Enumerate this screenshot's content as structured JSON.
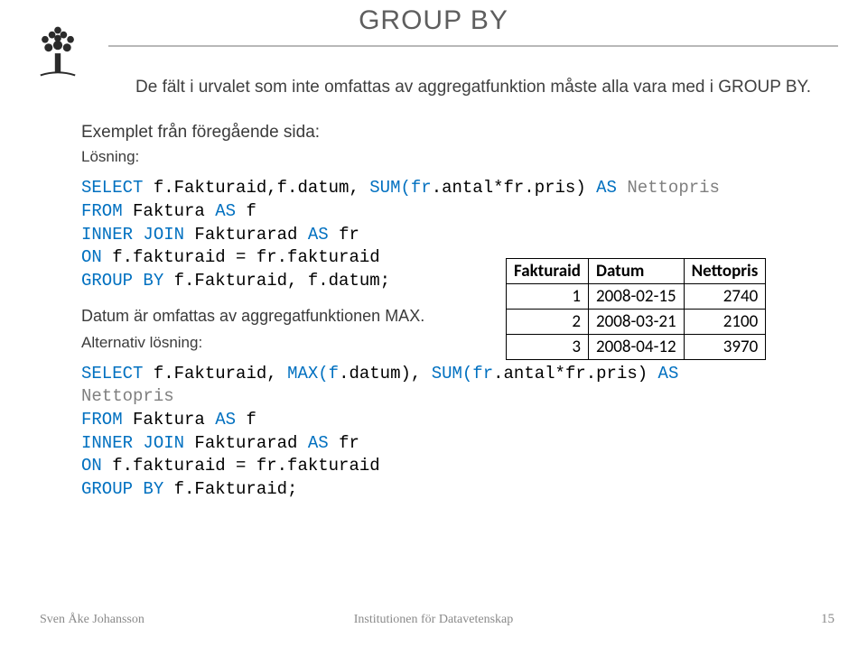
{
  "title": "GROUP BY",
  "intro": "De fält i urvalet som inte omfattas av aggregatfunktion måste alla vara med i GROUP BY.",
  "example_label": "Exemplet från föregående sida:",
  "solution_label": "Lösning:",
  "code1": {
    "l1a": "SELECT",
    "l1b": " f.Fakturaid,f.datum, ",
    "l1c": "SUM(fr",
    "l1d": ".antal*fr.pris)",
    "l1e": " AS ",
    "l1f": "Nettopris",
    "l2a": "FROM",
    "l2b": " Faktura ",
    "l2c": "AS",
    "l2d": " f",
    "l3a": "INNER JOIN",
    "l3b": " Fakturarad ",
    "l3c": "AS",
    "l3d": " fr",
    "l4a": "ON",
    "l4b": " f.fakturaid = fr.fakturaid",
    "l5a": "GROUP BY",
    "l5b": " f.Fakturaid, f.datum;"
  },
  "midnote": "Datum är omfattas av aggregatfunktionen MAX.",
  "alt_label": "Alternativ lösning:",
  "code2": {
    "l1a": "SELECT",
    "l1b": " f.Fakturaid, ",
    "l1c": "MAX(f",
    "l1d": ".datum), ",
    "l1e": "SUM(fr",
    "l1f": ".antal*fr.pris)",
    "l1g": " AS",
    "l2a": "Nettopris",
    "l3a": "FROM",
    "l3b": " Faktura ",
    "l3c": "AS",
    "l3d": " f",
    "l4a": "INNER JOIN",
    "l4b": " Fakturarad ",
    "l4c": "AS",
    "l4d": " fr",
    "l5a": "ON",
    "l5b": " f.fakturaid = fr.fakturaid",
    "l6a": "GROUP BY",
    "l6b": " f.Fakturaid;"
  },
  "table": {
    "headers": [
      "Fakturaid",
      "Datum",
      "Nettopris"
    ],
    "rows": [
      [
        "1",
        "2008-02-15",
        "2740"
      ],
      [
        "2",
        "2008-03-21",
        "2100"
      ],
      [
        "3",
        "2008-04-12",
        "3970"
      ]
    ]
  },
  "footer": {
    "author": "Sven Åke Johansson",
    "institution": "Institutionen för Datavetenskap",
    "page": "15"
  }
}
